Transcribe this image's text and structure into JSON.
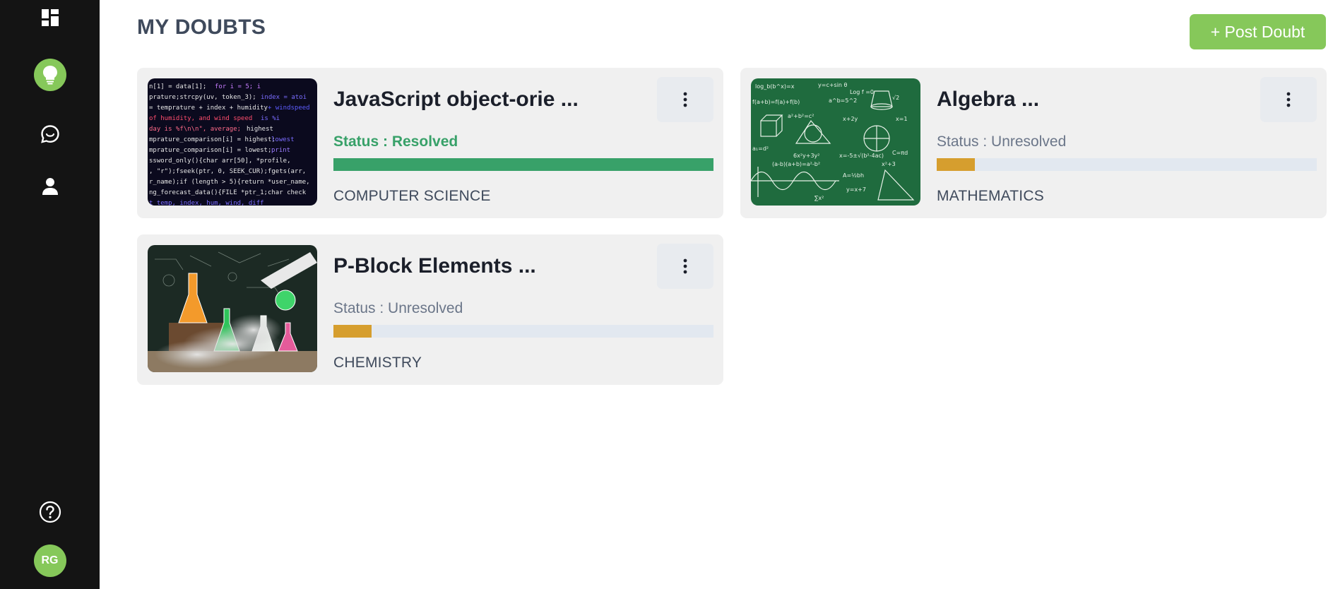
{
  "sidebar": {
    "icons": [
      "dashboard-icon",
      "lightbulb-icon",
      "chat-icon",
      "user-icon",
      "help-icon"
    ],
    "active_color": "#86c85a",
    "avatar": {
      "initials": "RG",
      "color": "#86c85a"
    }
  },
  "header": {
    "title": "MY DOUBTS",
    "post_button_label": "+ Post Doubt",
    "post_button_color": "#86c85a"
  },
  "doubts": [
    {
      "title": "JavaScript object-orie ...",
      "status": "Status : Resolved",
      "progress": 1.0,
      "progress_color": "#38a169",
      "subject": "COMPUTER SCIENCE",
      "thumbnail": "code-screen-image"
    },
    {
      "title": "Algebra ...",
      "status": "Status : Unresolved",
      "progress": 0.1,
      "progress_color": "#d69e2e",
      "subject": "MATHEMATICS",
      "thumbnail": "chalkboard-math-image"
    },
    {
      "title": "P-Block Elements ...",
      "status": "Status : Unresolved",
      "progress": 0.1,
      "progress_color": "#d69e2e",
      "subject": "CHEMISTRY",
      "thumbnail": "chemistry-flasks-image"
    }
  ]
}
